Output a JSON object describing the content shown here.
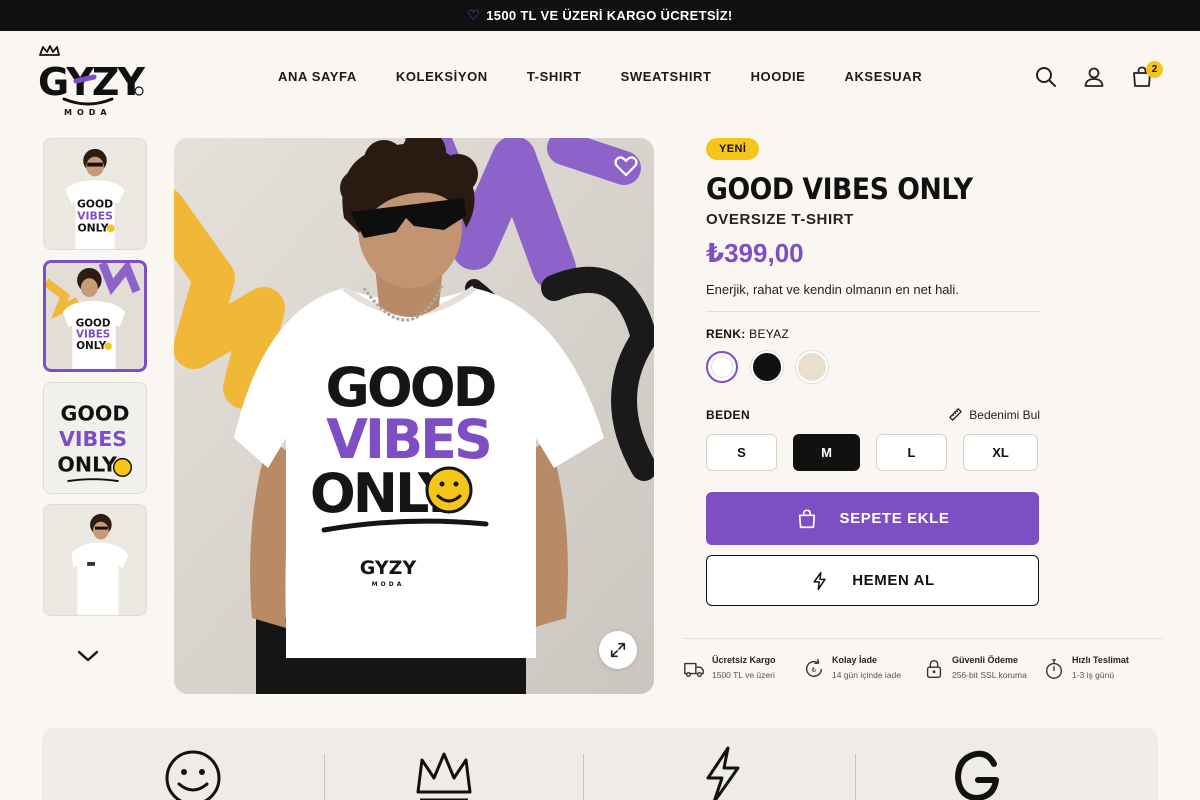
{
  "announcement": {
    "text": "1500 TL VE ÜZERİ KARGO ÜCRETSİZ!"
  },
  "brand": {
    "logo_text": "GYZY",
    "logo_sub": "MODA"
  },
  "nav": {
    "items": [
      {
        "label": "ANA SAYFA"
      },
      {
        "label": "KOLEKSİYON"
      },
      {
        "label": "T-SHIRT"
      },
      {
        "label": "SWEATSHIRT"
      },
      {
        "label": "HOODIE"
      },
      {
        "label": "AKSESUAR"
      }
    ]
  },
  "header_icons": {
    "search": "search-icon",
    "account": "user-icon",
    "cart": "bag-icon",
    "cart_count": "2"
  },
  "gallery": {
    "thumbnail_count": 4,
    "active_thumbnail": 2,
    "print_lines": [
      "GOOD",
      "VIBES",
      "ONLY"
    ],
    "shirt_logo": "GYZY",
    "shirt_logo_sub": "MODA"
  },
  "product": {
    "badge": "YENİ",
    "title": "GOOD VIBES ONLY",
    "subtitle": "OVERSIZE T-SHIRT",
    "price": "₺399,00",
    "description": "Enerjik, rahat ve kendin olmanın en net hali.",
    "color_label": "RENK:",
    "color_value": "BEYAZ",
    "colors": [
      {
        "name": "white",
        "hex": "#ffffff",
        "selected": true
      },
      {
        "name": "black",
        "hex": "#111111",
        "selected": false
      },
      {
        "name": "beige",
        "hex": "#e8dfd1",
        "selected": false
      }
    ],
    "size_label": "BEDEN",
    "size_guide": "Bedenimi Bul",
    "sizes": [
      {
        "label": "S",
        "selected": false
      },
      {
        "label": "M",
        "selected": true
      },
      {
        "label": "L",
        "selected": false
      },
      {
        "label": "XL",
        "selected": false
      }
    ],
    "add_to_cart": "SEPETE EKLE",
    "buy_now": "HEMEN AL"
  },
  "features": [
    {
      "icon": "truck-icon",
      "title": "Ücretsiz Kargo",
      "desc": "1500 TL ve üzeri"
    },
    {
      "icon": "return-icon",
      "title": "Kolay İade",
      "desc": "14 gün içinde iade"
    },
    {
      "icon": "lock-icon",
      "title": "Güvenli Ödeme",
      "desc": "256-bit SSL koruma"
    },
    {
      "icon": "stopwatch-icon",
      "title": "Hızlı Teslimat",
      "desc": "1-3 iş günü"
    }
  ],
  "colors": {
    "accent": "#7e4fc4",
    "badge": "#f5c518",
    "dark": "#111111",
    "background": "#faf7f3"
  }
}
